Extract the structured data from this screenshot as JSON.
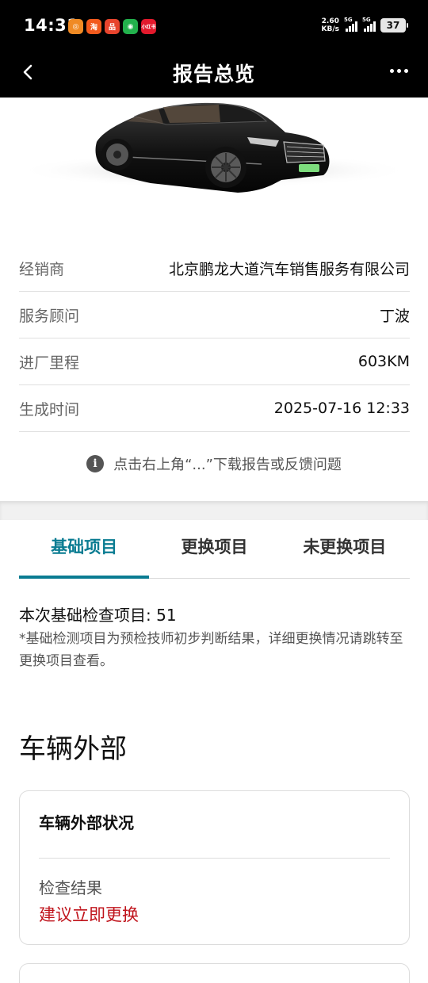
{
  "status_bar": {
    "time": "14:31",
    "net_speed_value": "2.60",
    "net_speed_unit": "KB/s",
    "signal1_label": "5G",
    "signal2_label": "5G",
    "battery": "37",
    "apps": [
      {
        "icon": "orange-app-icon",
        "color": "#f08a24",
        "glyph": "◎"
      },
      {
        "icon": "taobao-icon",
        "color": "#f25a1d",
        "glyph": "淘"
      },
      {
        "icon": "meituan-icon",
        "color": "#e8442d",
        "glyph": "品"
      },
      {
        "icon": "wechat-icon",
        "color": "#22b14c",
        "glyph": "◉"
      },
      {
        "icon": "xiaohongshu-icon",
        "color": "#e2192c",
        "glyph": "小红书"
      }
    ]
  },
  "navbar": {
    "title": "报告总览",
    "back_icon": "chevron-left-icon",
    "more_icon": "more-dots-icon"
  },
  "info_rows": [
    {
      "key": "经销商",
      "value": "北京鹏龙大道汽车销售服务有限公司"
    },
    {
      "key": "服务顾问",
      "value": "丁波"
    },
    {
      "key": "进厂里程",
      "value": "603KM"
    },
    {
      "key": "生成时间",
      "value": "2025-07-16 12:33"
    }
  ],
  "tip": {
    "icon": "info-icon",
    "text": "点击右上角“...”下载报告或反馈问题"
  },
  "tabs": [
    {
      "label": "基础项目",
      "active": true
    },
    {
      "label": "更换项目",
      "active": false
    },
    {
      "label": "未更换项目",
      "active": false
    }
  ],
  "summary": {
    "count_text": "本次基础检查项目: 51",
    "note": "*基础检测项目为预检技师初步判断结果，详细更换情况请跳转至更换项目查看。"
  },
  "category": {
    "title": "车辆外部",
    "card": {
      "title": "车辆外部状况",
      "result_label": "检查结果",
      "result_value": "建议立即更换"
    }
  },
  "colors": {
    "accent": "#0a7c92",
    "warning": "#c0141c"
  }
}
